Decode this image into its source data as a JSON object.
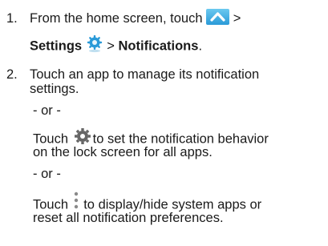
{
  "steps": [
    {
      "number": "1.",
      "line1_text": "From the home screen, touch",
      "line1_after": ">",
      "line2_bold_settings": "Settings",
      "line2_sep": ">",
      "line2_bold_notifications": "Notifications",
      "line2_end": ".",
      "icons": [
        "apps-up-arrow-icon",
        "settings-icon"
      ]
    },
    {
      "number": "2.",
      "line1_text": "Touch an app to manage its notification",
      "line2_text": "settings.",
      "or1": "- or -",
      "alt1_before": "Touch",
      "alt1_line1": "to set the notification behavior",
      "alt1_line2": "on the lock screen for all apps.",
      "or2": "- or -",
      "alt2_before": "Touch",
      "alt2_line1": "to display/hide system apps or",
      "alt2_line2": "reset all notification preferences.",
      "icons": [
        "gear-icon",
        "menu-dots-icon"
      ]
    }
  ],
  "colors": {
    "text": "#1a1a1a",
    "icon_blue": "#2a9ad8",
    "icon_gray": "#666666"
  }
}
